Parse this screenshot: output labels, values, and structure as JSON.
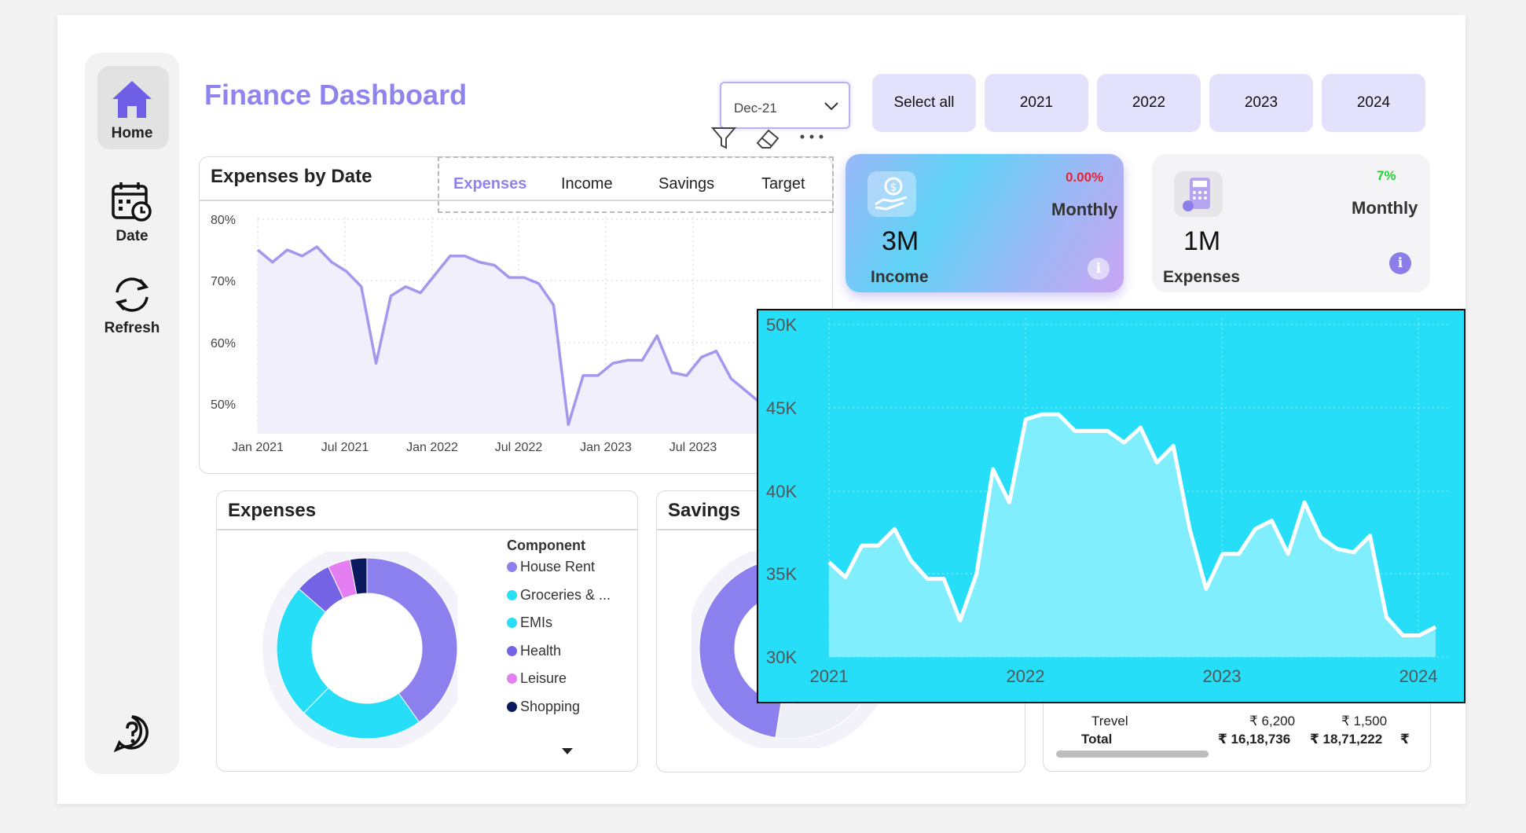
{
  "sidebar": {
    "items": [
      {
        "label": "Home",
        "icon": "home-icon"
      },
      {
        "label": "Date",
        "icon": "calendar-icon"
      },
      {
        "label": "Refresh",
        "icon": "refresh-icon"
      }
    ],
    "help_icon": "help-icon"
  },
  "header": {
    "title": "Finance Dashboard",
    "date_slicer": "Dec-21",
    "year_buttons": [
      "Select all",
      "2021",
      "2022",
      "2023",
      "2024"
    ]
  },
  "expenses_by_date": {
    "title": "Expenses by Date",
    "tabs": [
      "Expenses",
      "Income",
      "Savings",
      "Target"
    ],
    "active_tab": "Expenses",
    "chart_data": {
      "type": "area",
      "ylabels": [
        "80%",
        "70%",
        "60%",
        "50%"
      ],
      "xlabels": [
        "Jan 2021",
        "Jul 2021",
        "Jan 2022",
        "Jul 2022",
        "Jan 2023",
        "Jul 2023"
      ],
      "ylim": [
        45,
        80
      ],
      "x": [
        "2021-01",
        "2021-02",
        "2021-03",
        "2021-04",
        "2021-05",
        "2021-06",
        "2021-07",
        "2021-08",
        "2021-09",
        "2021-10",
        "2021-11",
        "2021-12",
        "2022-01",
        "2022-02",
        "2022-03",
        "2022-04",
        "2022-05",
        "2022-06",
        "2022-07",
        "2022-08",
        "2022-09",
        "2022-10",
        "2022-11",
        "2022-12",
        "2023-01",
        "2023-02",
        "2023-03",
        "2023-04",
        "2023-05",
        "2023-06",
        "2023-07",
        "2023-08",
        "2023-09",
        "2023-10",
        "2023-11"
      ],
      "values": [
        75,
        73,
        75,
        74,
        75.5,
        73,
        71.5,
        69,
        56.5,
        67.5,
        69,
        68,
        71,
        74,
        74,
        73,
        72.5,
        70.5,
        70.5,
        69.5,
        66,
        46.5,
        54.5,
        54.5,
        56.5,
        57,
        57,
        61,
        55,
        54.5,
        57.5,
        58.5,
        54,
        52,
        50
      ],
      "color": "#a596ee",
      "fill": "#f1effb",
      "grid": true
    }
  },
  "kpi_income": {
    "value": "3M",
    "label": "Income",
    "period": "Monthly",
    "change": "0.00%",
    "change_color": "#e0263a",
    "icon": "money-hand-icon"
  },
  "kpi_expenses": {
    "value": "1M",
    "label": "Expenses",
    "period": "Monthly",
    "change": "7%",
    "change_color": "#26d13a",
    "icon": "calculator-icon"
  },
  "expenses_donut": {
    "title": "Expenses",
    "legend_title": "Component",
    "chart_data": {
      "type": "pie",
      "labels": [
        "House Rent",
        "Groceries & ...",
        "EMIs",
        "Health",
        "Leisure",
        "Shopping"
      ],
      "values": [
        40,
        22,
        24,
        6.5,
        4,
        3
      ],
      "colors": [
        "#8c80ef",
        "#27def9",
        "#27def9",
        "#7563e6",
        "#e57ef3",
        "#0b1a5e"
      ]
    }
  },
  "savings": {
    "title": "Savings",
    "chart_data": {
      "type": "pie",
      "values": [
        55,
        25,
        20
      ],
      "colors": [
        "#8c80ef",
        "#27def9",
        "#eeeef6"
      ]
    }
  },
  "table": {
    "rows": [
      {
        "label": "Trevel",
        "col1": "₹ 6,200",
        "col2": "₹ 1,500"
      },
      {
        "label": "Total",
        "col1": "₹ 16,18,736",
        "col2": "₹ 18,71,222",
        "col3": "₹"
      }
    ]
  },
  "overlay_chart": {
    "chart_data": {
      "type": "area",
      "ylabels": [
        "50K",
        "45K",
        "40K",
        "35K",
        "30K"
      ],
      "xlabels": [
        "2021",
        "2022",
        "2023",
        "2024"
      ],
      "ylim": [
        30000,
        50000
      ],
      "x": [
        "2021-01",
        "2021-02",
        "2021-03",
        "2021-04",
        "2021-05",
        "2021-06",
        "2021-07",
        "2021-08",
        "2021-09",
        "2021-10",
        "2021-11",
        "2021-12",
        "2022-01",
        "2022-02",
        "2022-03",
        "2022-04",
        "2022-05",
        "2022-06",
        "2022-07",
        "2022-08",
        "2022-09",
        "2022-10",
        "2022-11",
        "2022-12",
        "2023-01",
        "2023-02",
        "2023-03",
        "2023-04",
        "2023-05",
        "2023-06",
        "2023-07",
        "2023-08",
        "2023-09",
        "2023-10",
        "2023-11",
        "2023-12",
        "2024-01",
        "2024-02"
      ],
      "values": [
        35700,
        34800,
        36700,
        36700,
        37700,
        35800,
        34700,
        34700,
        32200,
        35000,
        41300,
        39300,
        44300,
        44600,
        44600,
        43600,
        43600,
        43600,
        42900,
        43800,
        41700,
        42700,
        37700,
        34100,
        36200,
        36200,
        37700,
        38200,
        36200,
        39300,
        37200,
        36500,
        36300,
        37300,
        32400,
        31300,
        31300,
        31800
      ],
      "line_color": "#ffffff",
      "fill": "#80eefc",
      "grid": true
    }
  }
}
